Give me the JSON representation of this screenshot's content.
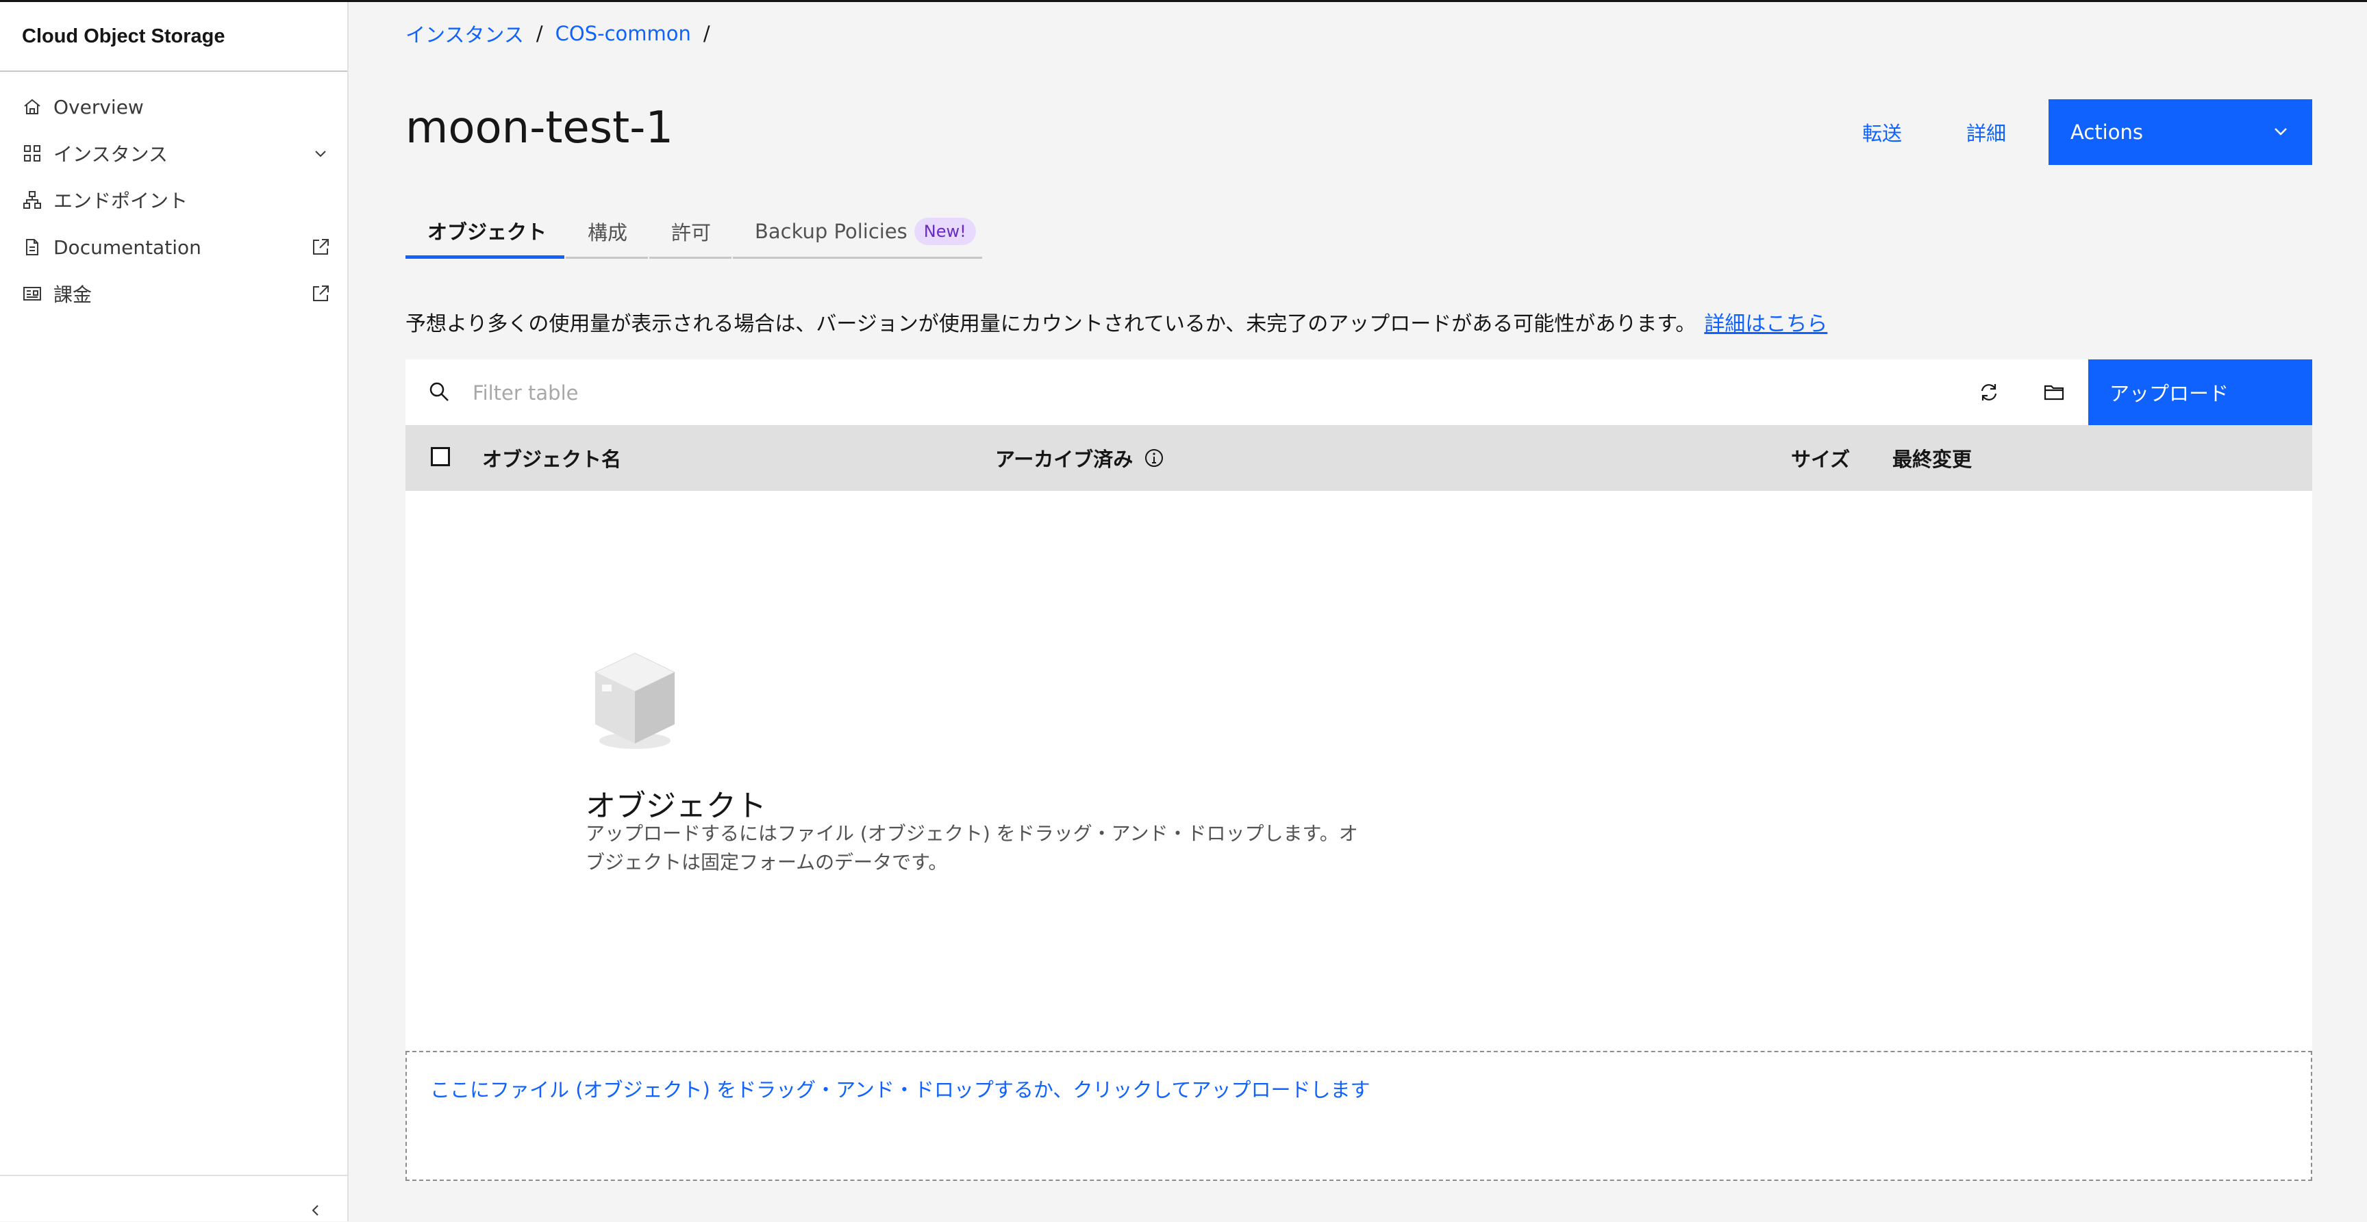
{
  "sidebar": {
    "title": "Cloud Object Storage",
    "items": [
      {
        "label": "Overview",
        "icon": "home-icon"
      },
      {
        "label": "インスタンス",
        "icon": "grid-icon"
      },
      {
        "label": "エンドポイント",
        "icon": "network-icon"
      },
      {
        "label": "Documentation",
        "icon": "document-icon"
      },
      {
        "label": "課金",
        "icon": "billing-icon"
      }
    ]
  },
  "breadcrumb": {
    "items": [
      "インスタンス",
      "COS-common"
    ],
    "separator": "/"
  },
  "page": {
    "title": "moon-test-1",
    "transfer_label": "転送",
    "details_label": "詳細",
    "actions_label": "Actions"
  },
  "tabs": [
    {
      "label": "オブジェクト",
      "active": true
    },
    {
      "label": "構成"
    },
    {
      "label": "許可"
    },
    {
      "label": "Backup Policies",
      "badge": "New!"
    }
  ],
  "notice": {
    "text": "予想より多くの使用量が表示される場合は、バージョンが使用量にカウントされているか、未完了のアップロードがある可能性があります。",
    "link": "詳細はこちら"
  },
  "toolbar": {
    "search_placeholder": "Filter table",
    "upload_label": "アップロード"
  },
  "table": {
    "columns": [
      "オブジェクト名",
      "アーカイブ済み",
      "サイズ",
      "最終変更"
    ]
  },
  "empty_state": {
    "title": "オブジェクト",
    "description": "アップロードするにはファイル (オブジェクト) をドラッグ・アンド・ドロップします。オブジェクトは固定フォームのデータです。"
  },
  "dropzone": {
    "text": "ここにファイル (オブジェクト) をドラッグ・アンド・ドロップするか、クリックしてアップロードします"
  },
  "colors": {
    "primary": "#0f62fe",
    "badge_bg": "#e8daff",
    "badge_text": "#6929c4"
  }
}
